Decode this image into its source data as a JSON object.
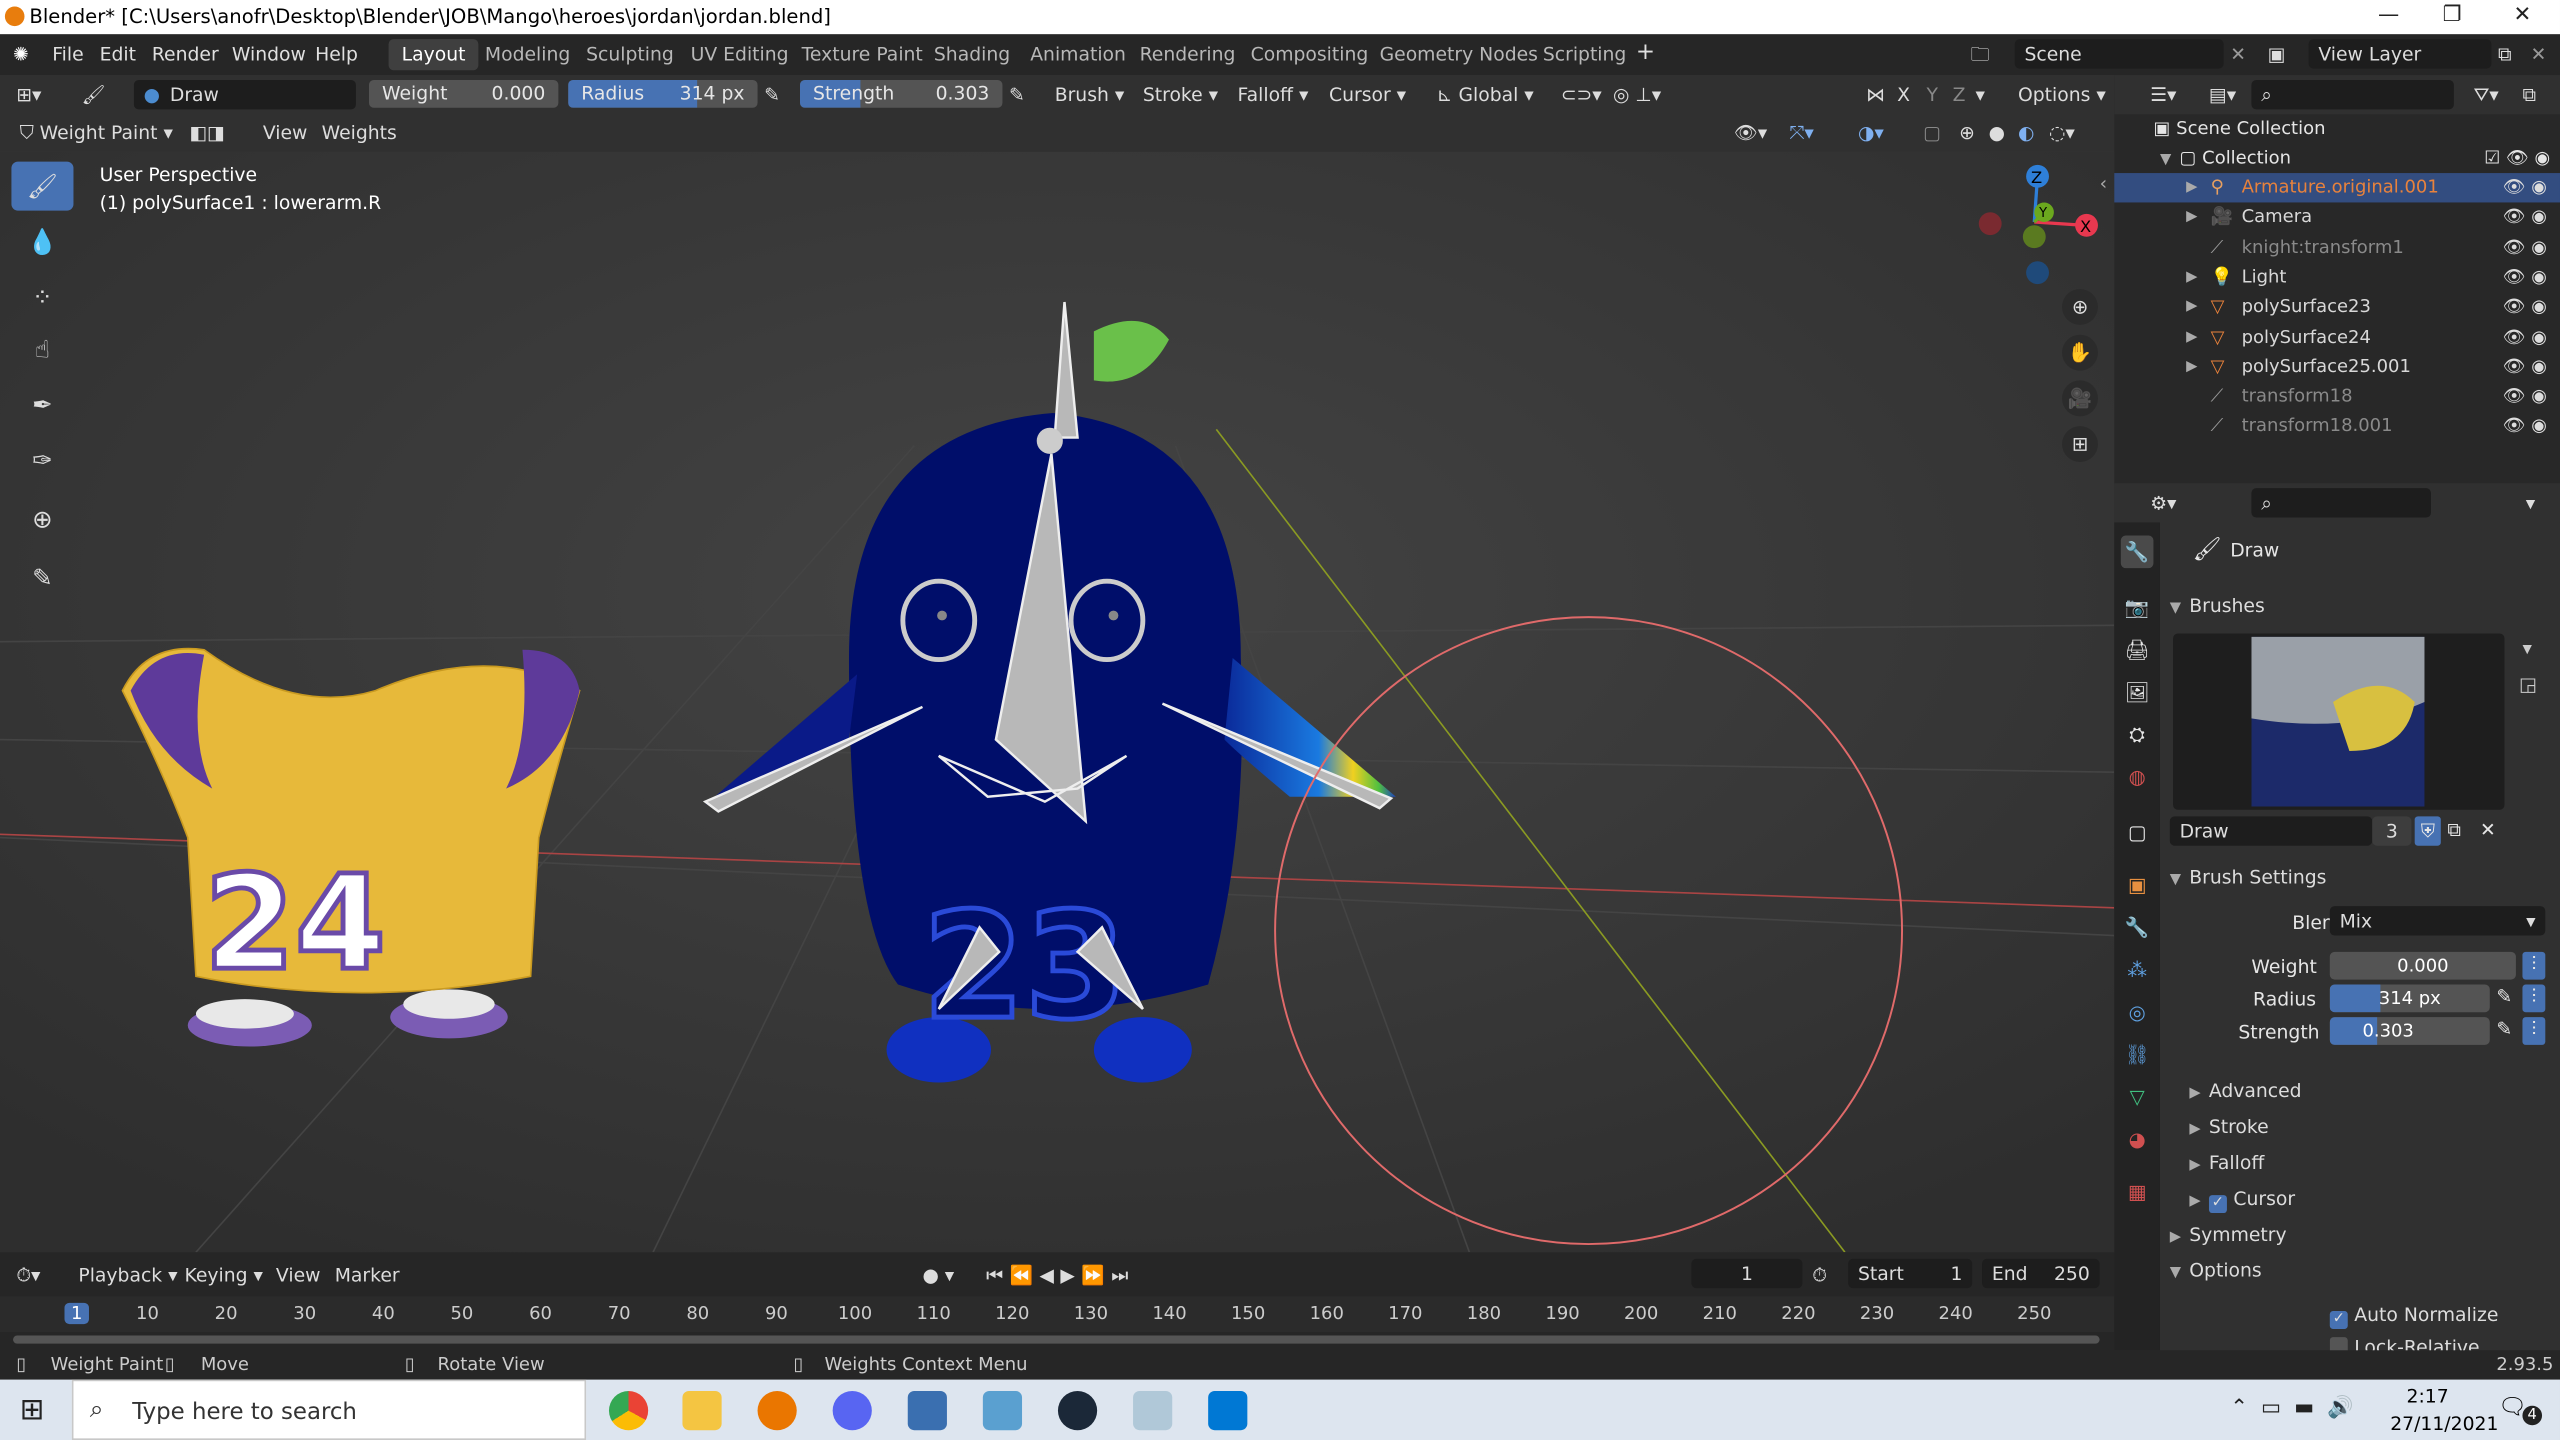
{
  "titlebar": {
    "title": "Blender* [C:\\Users\\anofr\\Desktop\\Blender\\JOB\\Mango\\heroes\\jordan\\jordan.blend]"
  },
  "menu": [
    "File",
    "Edit",
    "Render",
    "Window",
    "Help"
  ],
  "workspaces": [
    "Layout",
    "Modeling",
    "Sculpting",
    "UV Editing",
    "Texture Paint",
    "Shading",
    "Animation",
    "Rendering",
    "Compositing",
    "Geometry Nodes",
    "Scripting"
  ],
  "scene": {
    "label": "Scene",
    "view_layer": "View Layer"
  },
  "tool_header": {
    "brush_name": "Draw",
    "weight_label": "Weight",
    "weight": "0.000",
    "radius_label": "Radius",
    "radius": "314 px",
    "radius_fraction": 0.68,
    "strength_label": "Strength",
    "strength": "0.303",
    "strength_fraction": 0.3,
    "brush": "Brush",
    "stroke": "Stroke",
    "falloff": "Falloff",
    "cursor": "Cursor",
    "orientation": "Global",
    "options": "Options",
    "axes": [
      "X",
      "Y",
      "Z"
    ]
  },
  "viewport_header": {
    "mode": "Weight Paint",
    "view": "View",
    "weights": "Weights"
  },
  "viewport": {
    "perspective": "User Perspective",
    "object_info": "(1) polySurface1 : lowerarm.R",
    "gizmo_axes": [
      "Z",
      "Y",
      "X"
    ],
    "colors": {
      "x": "#e8384f",
      "y": "#6ba81e",
      "z": "#2e7fd8",
      "brush_circle": "#e06a6a"
    },
    "jersey_numbers": [
      "24",
      "23"
    ]
  },
  "timeline": {
    "playback": "Playback",
    "keying": "Keying",
    "view": "View",
    "marker": "Marker",
    "current_frame": "1",
    "start_label": "Start",
    "start": "1",
    "end_label": "End",
    "end": "250",
    "ruler": [
      "1",
      "10",
      "20",
      "30",
      "40",
      "50",
      "60",
      "70",
      "80",
      "90",
      "100",
      "110",
      "120",
      "130",
      "140",
      "150",
      "160",
      "170",
      "180",
      "190",
      "200",
      "210",
      "220",
      "230",
      "240",
      "250"
    ]
  },
  "status": {
    "left_action": "Weight Paint",
    "mid_action": "Move",
    "rotate": "Rotate View",
    "context": "Weights Context Menu",
    "version": "2.93.5"
  },
  "outliner": {
    "scene_collection": "Scene Collection",
    "collection": "Collection",
    "items": [
      {
        "name": "Armature.original.001",
        "color": "#e8823c",
        "icon": "armature-icon",
        "expand": true,
        "highlight": true
      },
      {
        "name": "Camera",
        "color": "#d8d8d8",
        "icon": "camera-icon",
        "expand": true
      },
      {
        "name": "knight:transform1",
        "color": "#8a8a8a",
        "icon": "bone-icon",
        "expand": false
      },
      {
        "name": "Light",
        "color": "#d8d8d8",
        "icon": "light-icon",
        "expand": true
      },
      {
        "name": "polySurface23",
        "color": "#d8d8d8",
        "icon": "mesh-icon",
        "expand": true
      },
      {
        "name": "polySurface24",
        "color": "#d8d8d8",
        "icon": "mesh-icon",
        "expand": true
      },
      {
        "name": "polySurface25.001",
        "color": "#d8d8d8",
        "icon": "mesh-icon",
        "expand": true
      },
      {
        "name": "transform18",
        "color": "#8a8a8a",
        "icon": "bone-icon",
        "expand": false
      },
      {
        "name": "transform18.001",
        "color": "#8a8a8a",
        "icon": "bone-icon",
        "expand": false
      }
    ]
  },
  "properties": {
    "tool_name": "Draw",
    "brushes": "Brushes",
    "brush_name": "Draw",
    "users": "3",
    "brush_settings": "Brush Settings",
    "blend_label": "Blend",
    "blend": "Mix",
    "weight_label": "Weight",
    "weight": "0.000",
    "radius_label": "Radius",
    "radius": "314 px",
    "radius_fraction": 0.32,
    "strength_label": "Strength",
    "strength": "0.303",
    "strength_fraction": 0.3,
    "advanced": "Advanced",
    "stroke": "Stroke",
    "falloff": "Falloff",
    "cursor": "Cursor",
    "symmetry": "Symmetry",
    "options": "Options",
    "auto_normalize": "Auto Normalize",
    "lock_relative": "Lock-Relative"
  },
  "taskbar": {
    "search_placeholder": "Type here to search",
    "time": "2:17",
    "date": "27/11/2021",
    "notifications": "4"
  }
}
